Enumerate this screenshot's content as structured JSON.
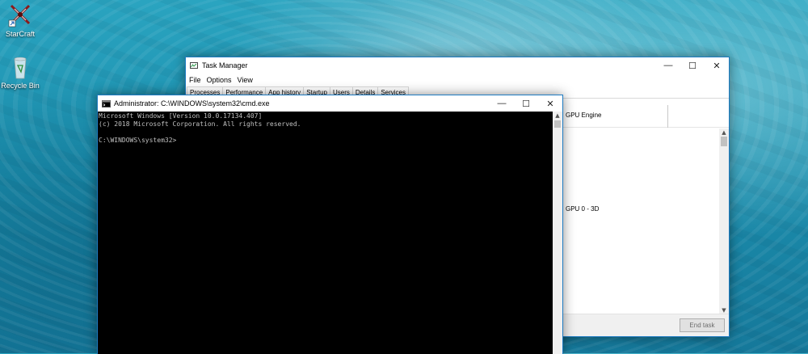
{
  "desktop": {
    "icons": [
      {
        "label": "StarCraft",
        "icon": "starcraft-icon"
      },
      {
        "label": "Recycle Bin",
        "icon": "recycle-bin-icon"
      }
    ]
  },
  "task_manager": {
    "title": "Task Manager",
    "caption_buttons": {
      "minimize": "—",
      "maximize": "☐",
      "close": "✕"
    },
    "menu": [
      "File",
      "Options",
      "View"
    ],
    "tabs": [
      "Processes",
      "Performance",
      "App history",
      "Startup",
      "Users",
      "Details",
      "Services"
    ],
    "active_tab": "Processes",
    "column_header": "GPU Engine",
    "row_value": "GPU 0 - 3D",
    "end_task_label": "End task"
  },
  "cmd": {
    "title": "Administrator: C:\\WINDOWS\\system32\\cmd.exe",
    "caption_buttons": {
      "minimize": "—",
      "maximize": "☐",
      "close": "✕"
    },
    "lines": [
      "Microsoft Windows [Version 10.0.17134.407]",
      "(c) 2018 Microsoft Corporation. All rights reserved.",
      "",
      "C:\\WINDOWS\\system32>"
    ]
  },
  "colors": {
    "window_border": "#1e7bc2",
    "console_bg": "#000000",
    "console_text": "#c0c0c0"
  }
}
